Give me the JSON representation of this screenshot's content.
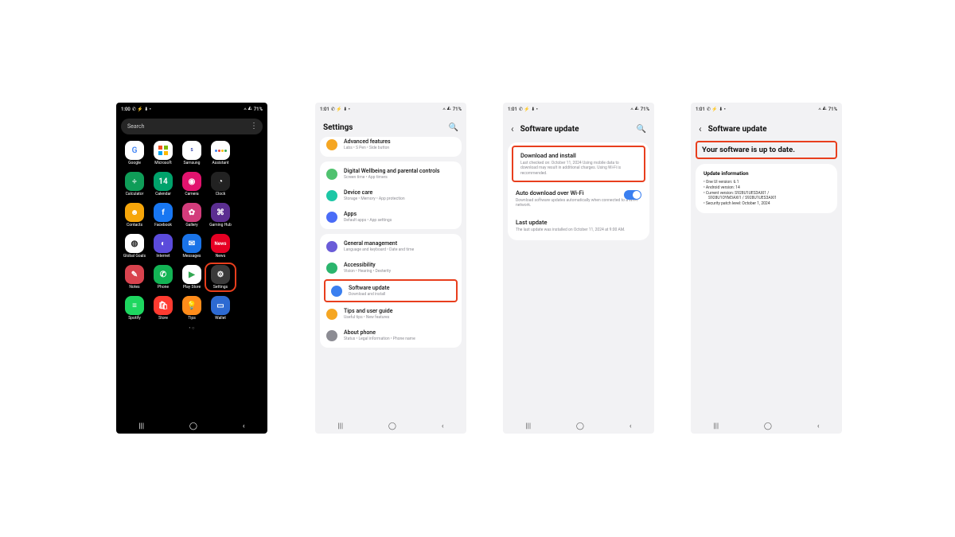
{
  "status": {
    "time1": "1:00",
    "time2": "1:01",
    "battery": "71%",
    "icons": "✆ ⚡ ⬇ •",
    "right_icons": "⟑ ◭"
  },
  "screen1": {
    "search_placeholder": "Search",
    "apps": [
      {
        "label": "Google",
        "cls": "ic-google",
        "glyph": "G"
      },
      {
        "label": "Microsoft",
        "cls": "ic-microsoft",
        "glyph": ""
      },
      {
        "label": "Samsung",
        "cls": "ic-samsung",
        "glyph": "S"
      },
      {
        "label": "Assistant",
        "cls": "ic-assistant",
        "glyph": ""
      },
      {
        "label": "",
        "cls": "",
        "glyph": ""
      },
      {
        "label": "Calculator",
        "cls": "ic-calc",
        "glyph": "÷"
      },
      {
        "label": "Calendar",
        "cls": "ic-calendar",
        "glyph": "14"
      },
      {
        "label": "Camera",
        "cls": "ic-camera",
        "glyph": "◉"
      },
      {
        "label": "Clock",
        "cls": "ic-clock",
        "glyph": "◔"
      },
      {
        "label": "",
        "cls": "",
        "glyph": ""
      },
      {
        "label": "Contacts",
        "cls": "ic-contacts",
        "glyph": "☻"
      },
      {
        "label": "Facebook",
        "cls": "ic-facebook",
        "glyph": "f"
      },
      {
        "label": "Gallery",
        "cls": "ic-gallery",
        "glyph": "✿"
      },
      {
        "label": "Gaming Hub",
        "cls": "ic-gaming",
        "glyph": "⌘"
      },
      {
        "label": "",
        "cls": "",
        "glyph": ""
      },
      {
        "label": "Global Goals",
        "cls": "ic-globe",
        "glyph": "◍"
      },
      {
        "label": "Internet",
        "cls": "ic-internet",
        "glyph": "◐"
      },
      {
        "label": "Messages",
        "cls": "ic-messages",
        "glyph": "✉"
      },
      {
        "label": "News",
        "cls": "ic-news",
        "glyph": "News"
      },
      {
        "label": "",
        "cls": "",
        "glyph": ""
      },
      {
        "label": "Notes",
        "cls": "ic-notes",
        "glyph": "✎"
      },
      {
        "label": "Phone",
        "cls": "ic-phone",
        "glyph": "✆"
      },
      {
        "label": "Play Store",
        "cls": "ic-play",
        "glyph": "▶"
      },
      {
        "label": "Settings",
        "cls": "ic-settings",
        "glyph": "⚙",
        "highlight": true
      },
      {
        "label": "",
        "cls": "",
        "glyph": ""
      },
      {
        "label": "Spotify",
        "cls": "ic-spotify",
        "glyph": "≡"
      },
      {
        "label": "Store",
        "cls": "ic-store",
        "glyph": "🛍"
      },
      {
        "label": "Tips",
        "cls": "ic-tips",
        "glyph": "💡"
      },
      {
        "label": "Wallet",
        "cls": "ic-wallet",
        "glyph": "▭"
      },
      {
        "label": "",
        "cls": "",
        "glyph": ""
      }
    ]
  },
  "screen2": {
    "title": "Settings",
    "top_partial": {
      "title": "Advanced features",
      "sub": "Labs • S Pen • Side button",
      "color": "#f5a623"
    },
    "rows": [
      {
        "color": "#50c26f",
        "title": "Digital Wellbeing and parental controls",
        "sub": "Screen time • App timers"
      },
      {
        "color": "#1cc7a6",
        "title": "Device care",
        "sub": "Storage • Memory • App protection"
      },
      {
        "color": "#4a6cf7",
        "title": "Apps",
        "sub": "Default apps • App settings"
      }
    ],
    "rows2": [
      {
        "color": "#6a5cd8",
        "title": "General management",
        "sub": "Language and keyboard • Date and time"
      },
      {
        "color": "#2bb56d",
        "title": "Accessibility",
        "sub": "Vision • Hearing • Dexterity"
      },
      {
        "color": "#3a7ff0",
        "title": "Software update",
        "sub": "Download and install",
        "highlight": true
      },
      {
        "color": "#f5a623",
        "title": "Tips and user guide",
        "sub": "Useful tips • New features"
      },
      {
        "color": "#8c8c93",
        "title": "About phone",
        "sub": "Status • Legal information • Phone name"
      }
    ]
  },
  "screen3": {
    "title": "Software update",
    "rows": [
      {
        "title": "Download and install",
        "sub": "Last checked on: October 11, 2024\nUsing mobile data to download may result in additional charges. Using Wi-Fi is recommended.",
        "highlight": true
      },
      {
        "title": "Auto download over Wi-Fi",
        "sub": "Download software updates automatically when connected to a Wi-Fi network.",
        "toggle": true
      },
      {
        "title": "Last update",
        "sub": "The last update was installed on October 11, 2024 at 9:00 AM."
      }
    ]
  },
  "screen4": {
    "title": "Software update",
    "banner": "Your software is up to date.",
    "info_header": "Update information",
    "info_lines": [
      "• One UI version: 6.1",
      "• Android version: 14",
      "• Current version: S928U1UES3AXI1 /",
      "  S928U1OYM3AXI1 / S928U1UES3AXI1",
      "• Security patch level: October 1, 2024"
    ]
  },
  "nav": {
    "recents": "|||",
    "home": "◯",
    "back": "‹"
  }
}
